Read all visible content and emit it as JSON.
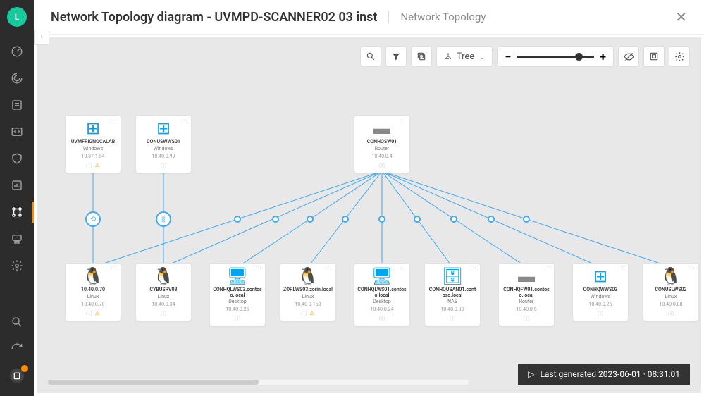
{
  "avatar_letter": "L",
  "header": {
    "title": "Network Topology diagram - UVMPD-SCANNER02 03 inst",
    "breadcrumb": "Network Topology"
  },
  "toolbar": {
    "tree_label": "Tree"
  },
  "status": {
    "label": "Last generated 2023-06-01 · 08:31:01"
  },
  "nodes": {
    "top1": {
      "name": "UVMFRIGNOCALAB",
      "type": "Windows",
      "ip": "10.37.1.54"
    },
    "top2": {
      "name": "CONUSWWS01",
      "type": "Windows",
      "ip": "10.40.0.99"
    },
    "top3": {
      "name": "CONHQSW01",
      "type": "Router",
      "ip": "10.40.0.4"
    },
    "b0": {
      "name": "10.40.0.70",
      "type": "Linux",
      "ip": "10.40.0.70"
    },
    "b1": {
      "name": "CYBUSRV03",
      "type": "Linux",
      "ip": "10.40.0.34"
    },
    "b2": {
      "name": "CONHQLWS03.contoso.local",
      "type": "Desktop",
      "ip": "10.40.0.25"
    },
    "b3": {
      "name": "ZORLWS03.zorin.local",
      "type": "Linux",
      "ip": "10.40.0.150"
    },
    "b4": {
      "name": "CONHQLWS01.contoso.local",
      "type": "Desktop",
      "ip": "10.40.0.24"
    },
    "b5": {
      "name": "CONHQUSAN01.contoso.local",
      "type": "NAS",
      "ip": "10.40.0.30"
    },
    "b6": {
      "name": "CONHQFW01.contoso.local",
      "type": "Router",
      "ip": "10.40.0.5"
    },
    "b7": {
      "name": "CONHQWWS03",
      "type": "Windows",
      "ip": "10.40.0.26"
    },
    "b8": {
      "name": "CONUSLWS02",
      "type": "Linux",
      "ip": "10.40.0.88"
    }
  }
}
